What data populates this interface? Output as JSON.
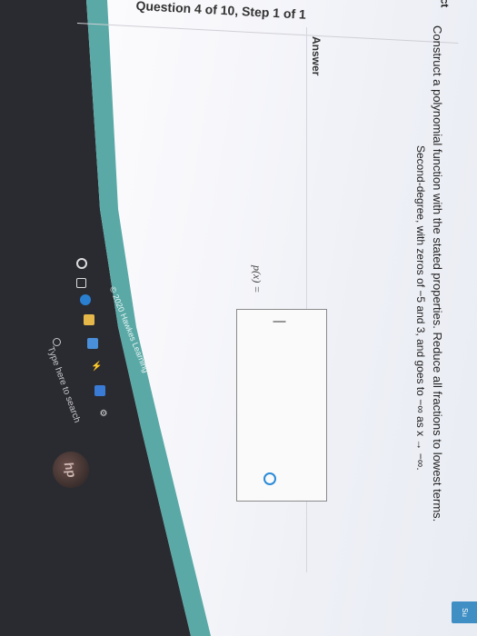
{
  "header": {
    "breadcrumb": "Question 4 of 10, Step 1 of 1",
    "status": "Correct"
  },
  "question": {
    "prompt": "Construct a polynomial function with the stated properties. Reduce all fractions to lowest terms.",
    "properties": "Second-degree, with zeros of −5 and 3, and goes to −∞ as x → −∞."
  },
  "answer": {
    "label": "Answer",
    "function_label": "p(x) =",
    "value": ""
  },
  "footer": {
    "copyright": "© 2020 Hawkes Learning"
  },
  "submit": {
    "label": "Su"
  },
  "taskbar": {
    "search_placeholder": "Type here to search",
    "icons": [
      "cortana-icon",
      "task-view-icon",
      "edge-icon",
      "folder-icon",
      "store-icon",
      "flash-icon",
      "mail-icon",
      "gear-icon"
    ]
  },
  "hardware": {
    "logo": "hp"
  }
}
